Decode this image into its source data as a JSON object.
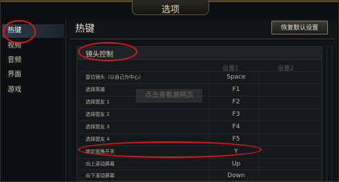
{
  "window": {
    "title": "选项"
  },
  "sidebar": {
    "items": [
      {
        "label": "热键",
        "active": true
      },
      {
        "label": "视频",
        "active": false
      },
      {
        "label": "音频",
        "active": false
      },
      {
        "label": "界面",
        "active": false
      },
      {
        "label": "游戏",
        "active": false
      }
    ]
  },
  "main": {
    "title": "热键",
    "reset_button": "恢复默认设置",
    "section_title": "镜头控制",
    "columns": [
      "设置1",
      "设置2"
    ],
    "rows": [
      {
        "action": "复位镜头（以自己为中心）",
        "key1": "Space",
        "key2": ""
      },
      {
        "action": "选择英雄",
        "key1": "F1",
        "key2": ""
      },
      {
        "action": "选择盟友 1",
        "key1": "F2",
        "key2": ""
      },
      {
        "action": "选择盟友 2",
        "key1": "F3",
        "key2": ""
      },
      {
        "action": "选择盟友 3",
        "key1": "F4",
        "key2": ""
      },
      {
        "action": "选择盟友 4",
        "key1": "F5",
        "key2": ""
      },
      {
        "action": "锁定视角开关",
        "key1": "Y",
        "key2": ""
      },
      {
        "action": "向上滚动屏幕",
        "key1": "Up",
        "key2": ""
      },
      {
        "action": "向下滚动屏幕",
        "key1": "Down",
        "key2": ""
      }
    ]
  },
  "watermark": "点击查看源网页",
  "colors": {
    "highlight": "#e01818",
    "accent": "#2d3c48"
  }
}
